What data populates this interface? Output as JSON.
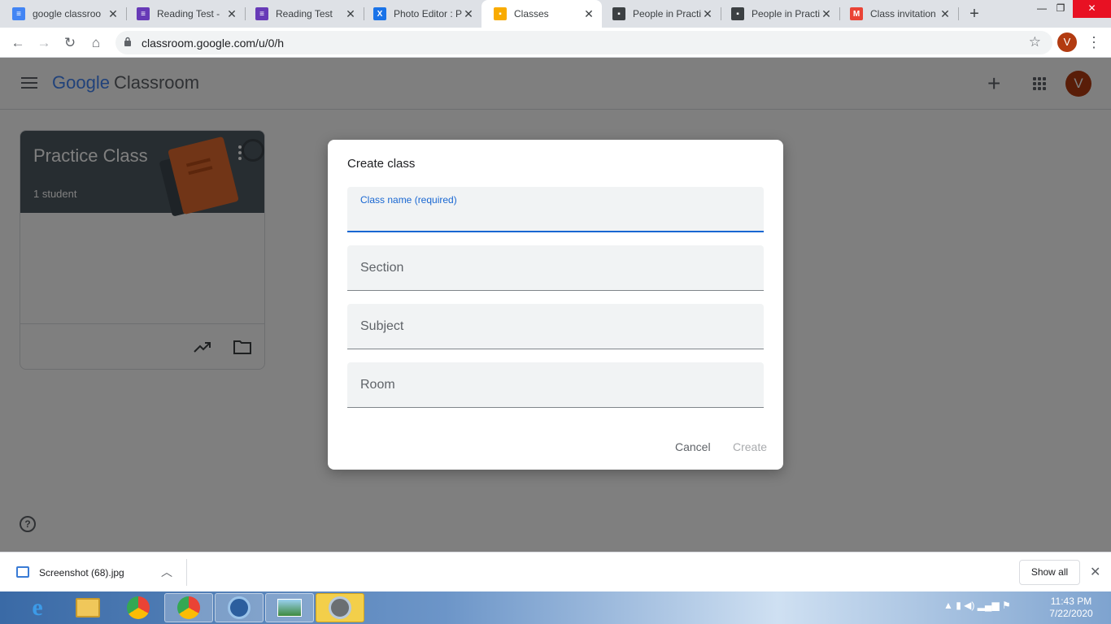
{
  "browser": {
    "tabs": [
      {
        "title": "google classroo",
        "icon": "docs-icon",
        "color": "#4285f4"
      },
      {
        "title": "Reading Test - ",
        "icon": "forms-icon",
        "color": "#673ab7"
      },
      {
        "title": "Reading Test",
        "icon": "forms-icon",
        "color": "#673ab7"
      },
      {
        "title": "Photo Editor : P",
        "icon": "photo-editor-icon",
        "color": "#1a73e8"
      },
      {
        "title": "Classes",
        "icon": "classroom-icon",
        "color": "#f9ab00"
      },
      {
        "title": "People in Practi",
        "icon": "classroom-icon",
        "color": "#3c4043"
      },
      {
        "title": "People in Practi",
        "icon": "classroom-icon",
        "color": "#3c4043"
      },
      {
        "title": "Class invitation",
        "icon": "gmail-icon",
        "color": "#ea4335"
      }
    ],
    "url": "classroom.google.com/u/0/h",
    "profile_initial": "V"
  },
  "app": {
    "logo_google": "Google",
    "logo_product": "Classroom",
    "avatar_initial": "V",
    "class_card": {
      "name": "Practice Class",
      "count": "1 student"
    },
    "help_glyph": "?"
  },
  "dialog": {
    "title": "Create class",
    "fields": [
      {
        "label": "Class name (required)"
      },
      {
        "label": "Section"
      },
      {
        "label": "Subject"
      },
      {
        "label": "Room"
      }
    ],
    "cancel_label": "Cancel",
    "create_label": "Create"
  },
  "downloads": {
    "file_name": "Screenshot (68).jpg",
    "show_all_label": "Show all"
  },
  "taskbar": {
    "time": "11:43 PM",
    "date": "7/22/2020"
  },
  "colors": {
    "accent": "#1967d2",
    "avatar": "#b23b11",
    "card_banner": "#4f5a62"
  }
}
